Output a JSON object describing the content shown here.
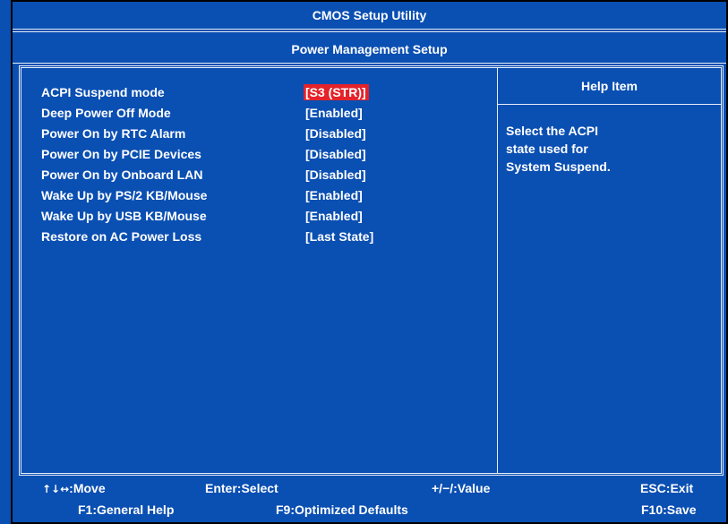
{
  "title": "CMOS Setup Utility",
  "subtitle": "Power Management Setup",
  "settings": [
    {
      "label": "ACPI Suspend mode",
      "value": "[S3 (STR)]",
      "selected": true
    },
    {
      "label": "Deep Power Off Mode",
      "value": "[Enabled]"
    },
    {
      "label": "Power On by RTC Alarm",
      "value": "[Disabled]"
    },
    {
      "label": "Power On by PCIE Devices",
      "value": "[Disabled]"
    },
    {
      "label": "Power On by Onboard LAN",
      "value": "[Disabled]"
    },
    {
      "label": "Wake Up by PS/2 KB/Mouse",
      "value": "[Enabled]"
    },
    {
      "label": "Wake Up by USB KB/Mouse",
      "value": "[Enabled]"
    },
    {
      "label": "Restore on AC Power Loss",
      "value": "[Last State]"
    }
  ],
  "help": {
    "header": "Help Item",
    "lines": [
      "Select the ACPI",
      "state used for",
      "System Suspend."
    ]
  },
  "footer": {
    "move_arrows": "↑↓↔",
    "move": ":Move",
    "enter": "Enter:Select",
    "value": "+/−/:Value",
    "esc": "ESC:Exit",
    "f1": "F1:General Help",
    "f9": "F9:Optimized Defaults",
    "f10": "F10:Save"
  },
  "colors": {
    "background": "#0a4fb2",
    "selected": "#e4222a",
    "text": "#ffffff"
  }
}
